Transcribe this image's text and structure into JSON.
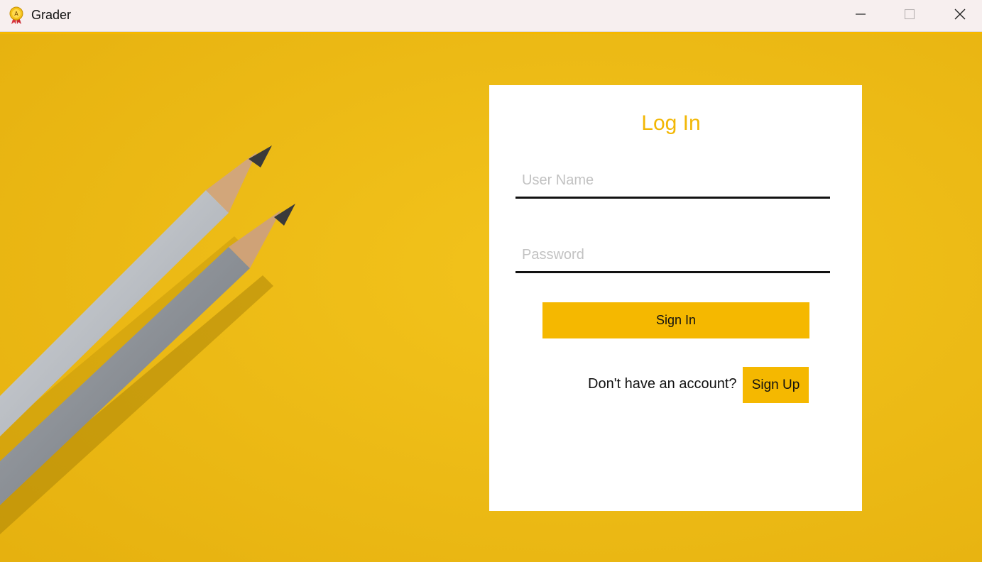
{
  "window": {
    "title": "Grader",
    "icon": "award-ribbon-icon",
    "controls": [
      "minimize-icon",
      "maximize-icon",
      "close-icon"
    ]
  },
  "background": {
    "description_icon": "pencils-background-image"
  },
  "login": {
    "title": "Log In",
    "username_placeholder": "User Name",
    "username_value": "",
    "password_placeholder": "Password",
    "password_value": "",
    "signin_label": "Sign In",
    "signup_prompt": "Don't have an account?",
    "signup_label": "Sign Up"
  },
  "colors": {
    "accent": "#f5b800",
    "title_color": "#f2b705",
    "card": "#ffffff",
    "titlebar": "#f7efef"
  }
}
